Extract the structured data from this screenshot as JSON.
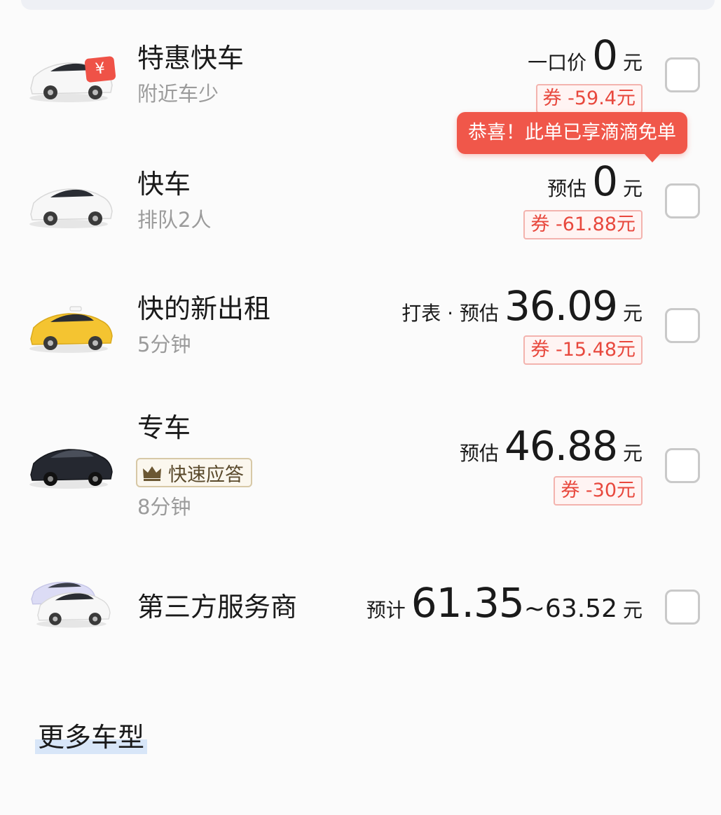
{
  "rows": [
    {
      "name": "特惠快车",
      "sub": "附近车少",
      "price_label": "一口价",
      "price": "0",
      "unit": "元",
      "coupon": "券 -59.4元",
      "car": "white-discount"
    },
    {
      "name": "快车",
      "sub": "排队2人",
      "price_label": "预估",
      "price": "0",
      "unit": "元",
      "coupon": "券 -61.88元",
      "car": "white"
    },
    {
      "name": "快的新出租",
      "sub": "5分钟",
      "price_label": "打表 · 预估",
      "price": "36.09",
      "unit": "元",
      "coupon": "券 -15.48元",
      "car": "yellow-taxi"
    },
    {
      "name": "专车",
      "badge": "快速应答",
      "sub": "8分钟",
      "price_label": "预估",
      "price": "46.88",
      "unit": "元",
      "coupon": "券 -30元",
      "car": "black"
    },
    {
      "name": "第三方服务商",
      "price_label": "预计",
      "price": "61.35",
      "price_range": "~63.52",
      "unit": "元",
      "car": "multi"
    }
  ],
  "tooltip": "恭喜！此单已享滴滴免单",
  "more_label": "更多车型",
  "icons": {
    "discount": "yen-tag-icon",
    "crown": "crown-icon"
  },
  "colors": {
    "accent_red": "#e8483d",
    "tooltip_bg": "#f0574a",
    "checkbox_border": "#c9c9c9"
  }
}
